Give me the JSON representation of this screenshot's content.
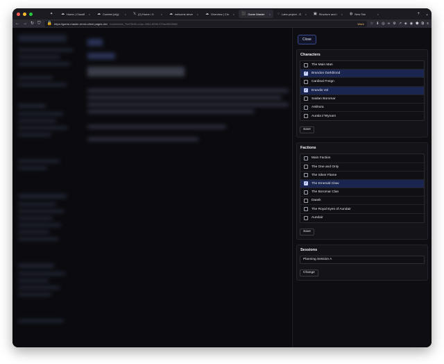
{
  "browser": {
    "tabs": [
      {
        "icon": "✦",
        "label": "",
        "active": false
      },
      {
        "icon": "☁",
        "label": "Home | Cloudflare",
        "active": false
      },
      {
        "icon": "☁",
        "label": "Contest (cfg) · Cloud",
        "active": false
      },
      {
        "icon": "𝕏",
        "label": "(2) Home / X",
        "active": false
      },
      {
        "icon": "☁",
        "label": "welcome.developer",
        "active": false
      },
      {
        "icon": "☁",
        "label": "Overview | Cloudfla",
        "active": false
      },
      {
        "icon": "⬛",
        "label": "Game Master",
        "active": true
      },
      {
        "icon": "◌",
        "label": "Labs project - Digita",
        "active": false
      },
      {
        "icon": "▣",
        "label": "Structure and interp",
        "active": false
      },
      {
        "icon": "◍",
        "label": "New Tab",
        "active": false
      }
    ],
    "url_main": "https://game-master-remix-client.pages.dev",
    "url_rest": "/notes/note_7bd78c9b-c1ac-4062-8298-372ac9803988",
    "work_label": "Work"
  },
  "panel": {
    "close_label": "Close",
    "characters": {
      "title": "Characters",
      "items": [
        {
          "label": "The Main Man",
          "checked": false
        },
        {
          "label": "Brandon Darkblood",
          "checked": true
        },
        {
          "label": "Cardinal Freign",
          "checked": false
        },
        {
          "label": "Erandis Vol",
          "checked": true
        },
        {
          "label": "Saidan Boromar",
          "checked": false
        },
        {
          "label": "Askhora",
          "checked": false
        },
        {
          "label": "Aurala ir'Wynarn",
          "checked": false
        }
      ],
      "save_label": "Save"
    },
    "factions": {
      "title": "Factions",
      "items": [
        {
          "label": "Main Faction",
          "checked": false
        },
        {
          "label": "The One and Only",
          "checked": false
        },
        {
          "label": "The Silver Flame",
          "checked": false
        },
        {
          "label": "The Emerald Claw",
          "checked": true
        },
        {
          "label": "The Boromar Clan",
          "checked": false
        },
        {
          "label": "Daask",
          "checked": false
        },
        {
          "label": "The Royal Eyes of Aundair",
          "checked": false
        },
        {
          "label": "Aundair",
          "checked": false
        }
      ],
      "save_label": "Save"
    },
    "sessions": {
      "title": "Sessions",
      "value": "Planning Session A",
      "change_label": "Change"
    }
  }
}
